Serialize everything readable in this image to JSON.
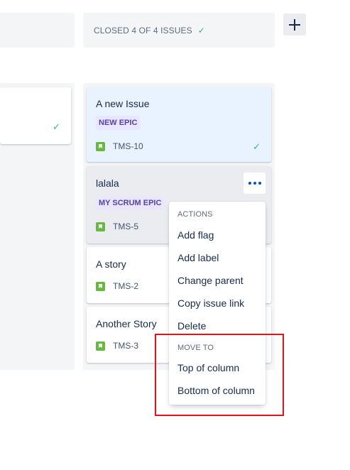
{
  "columns": {
    "closed": {
      "title": "CLOSED 4 OF 4 ISSUES"
    }
  },
  "add_column": {
    "label": "+"
  },
  "left_card": {},
  "cards": [
    {
      "title": "A new Issue",
      "epic": "NEW EPIC",
      "key": "TMS-10"
    },
    {
      "title": "lalala",
      "epic": "MY SCRUM EPIC",
      "key": "TMS-5"
    },
    {
      "title": "A story",
      "key": "TMS-2"
    },
    {
      "title": "Another Story",
      "key": "TMS-3"
    }
  ],
  "menu": {
    "actions_heading": "ACTIONS",
    "actions": [
      "Add flag",
      "Add label",
      "Change parent",
      "Copy issue link",
      "Delete"
    ],
    "move_heading": "MOVE TO",
    "move": [
      "Top of column",
      "Bottom of column"
    ]
  },
  "icons": {
    "check": "check-icon",
    "story": "story-icon",
    "more": "more-icon",
    "plus": "plus-icon"
  },
  "colors": {
    "accent": "#0052cc",
    "done": "#36b37e",
    "story": "#63ba3c",
    "epic_bg": "#eae6ff",
    "epic_text": "#5243aa",
    "highlight": "#e5141b"
  }
}
